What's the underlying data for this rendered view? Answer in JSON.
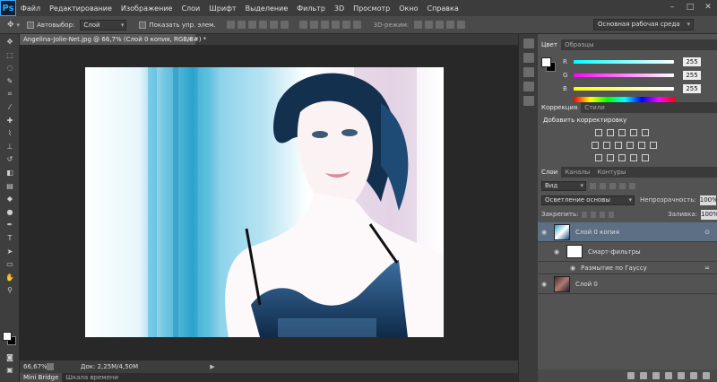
{
  "app": {
    "logo": "Ps",
    "menu": [
      "Файл",
      "Редактирование",
      "Изображение",
      "Слои",
      "Шрифт",
      "Выделение",
      "Фильтр",
      "3D",
      "Просмотр",
      "Окно",
      "Справка"
    ],
    "window_controls": [
      "–",
      "□",
      "✕"
    ]
  },
  "options": {
    "autoselect_label": "Автовыбор:",
    "autoselect_value": "Слой",
    "show_controls_label": "Показать упр. элем.",
    "mode3d_label": "3D-режим:",
    "workspace": "Основная рабочая среда"
  },
  "document": {
    "tab_title": "Angelina-Jolie-Net.jpg @ 66,7% (Слой 0 копия, RGB/8#) *",
    "close": "×",
    "zoom": "66,67%",
    "doc_size": "Док: 2,25M/4,50M"
  },
  "bottom_tabs": [
    "Mini Bridge",
    "Шкала времени"
  ],
  "color_panel": {
    "tabs": [
      "Цвет",
      "Образцы"
    ],
    "channels": [
      {
        "label": "R",
        "value": "255",
        "gradient_start": "#00ffff",
        "gradient_end": "#ffffff"
      },
      {
        "label": "G",
        "value": "255",
        "gradient_start": "#ff00ff",
        "gradient_end": "#ffffff"
      },
      {
        "label": "B",
        "value": "255",
        "gradient_start": "#ffff00",
        "gradient_end": "#ffffff"
      }
    ]
  },
  "adjustments_panel": {
    "tabs": [
      "Коррекция",
      "Стили"
    ],
    "title": "Добавить корректировку"
  },
  "layers_panel": {
    "tabs": [
      "Слои",
      "Каналы",
      "Контуры"
    ],
    "filter_kind": "Вид",
    "blend_mode": "Осветление основы",
    "opacity_label": "Непрозрачность:",
    "opacity_value": "100%",
    "lock_label": "Закрепить:",
    "fill_label": "Заливка:",
    "fill_value": "100%",
    "layers": [
      {
        "name": "Слой 0 копия",
        "selected": true
      },
      {
        "name": "Смарт-фильтры",
        "selected": false
      },
      {
        "name": "Размытие по Гауссу",
        "selected": false
      },
      {
        "name": "Слой 0",
        "selected": false
      }
    ]
  }
}
